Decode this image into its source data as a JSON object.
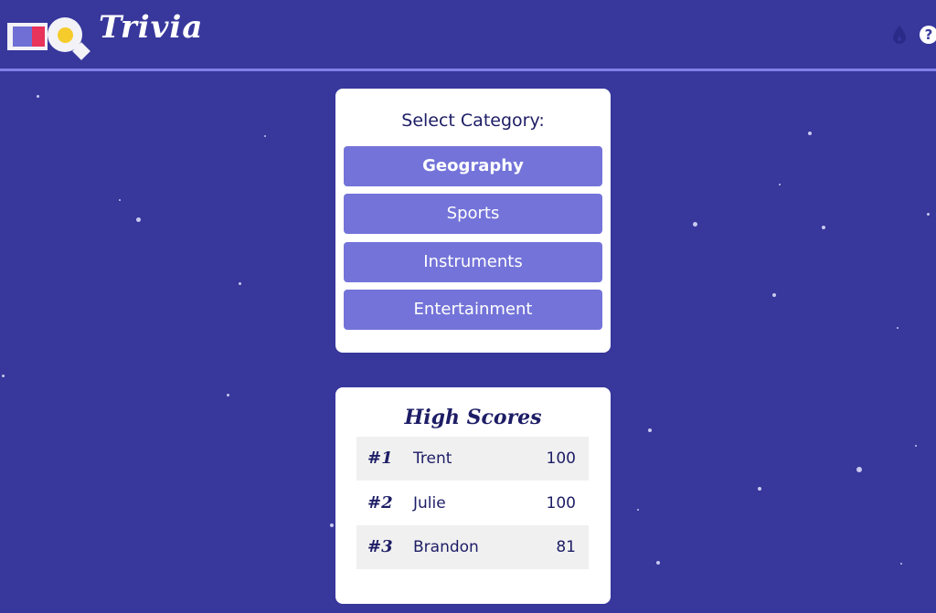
{
  "header": {
    "app_title": "Trivia",
    "logo_alt": "IQ",
    "icons": [
      "drop-icon",
      "help-icon"
    ],
    "help_glyph": "?"
  },
  "category": {
    "heading": "Select Category:",
    "options": [
      "Geography",
      "Sports",
      "Instruments",
      "Entertainment"
    ],
    "selected": "Geography"
  },
  "high_scores": {
    "title": "High Scores",
    "rows": [
      {
        "rank": "#1",
        "name": "Trent",
        "score": "100"
      },
      {
        "rank": "#2",
        "name": "Julie",
        "score": "100"
      },
      {
        "rank": "#3",
        "name": "Brandon",
        "score": "81"
      }
    ]
  },
  "colors": {
    "background": "#37379c",
    "header_rule": "#8080e8",
    "button": "#7373d9",
    "text_dark": "#1d1d66",
    "logo_red": "#e8335a",
    "logo_yellow": "#f5cc2c"
  }
}
